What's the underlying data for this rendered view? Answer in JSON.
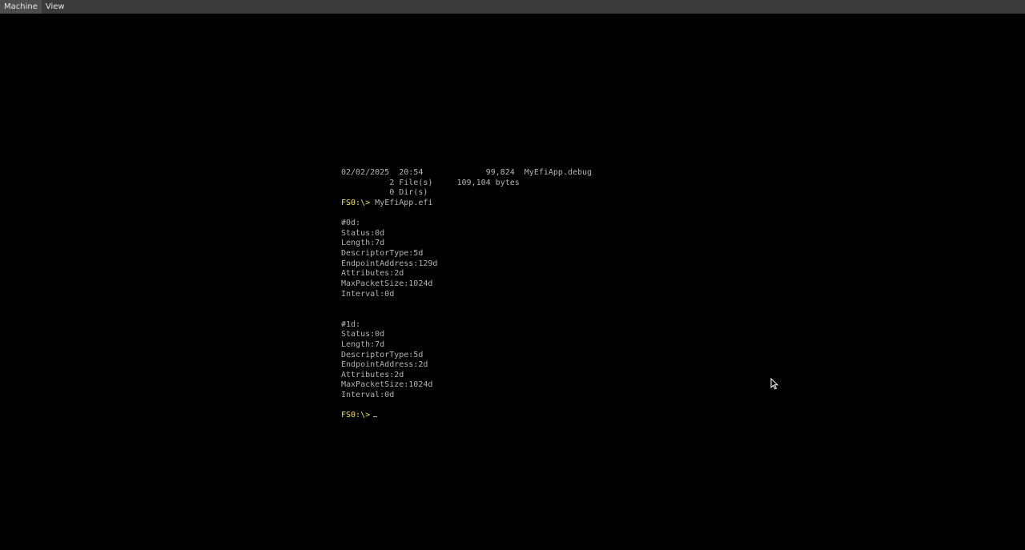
{
  "menubar": {
    "items": [
      {
        "label": "Machine"
      },
      {
        "label": "View"
      }
    ]
  },
  "console": {
    "lines": [
      {
        "text": "02/02/2025  20:54             99,824  MyEfiApp.debug",
        "prompt": ""
      },
      {
        "text": "          2 File(s)     109,104 bytes",
        "prompt": ""
      },
      {
        "text": "          0 Dir(s)",
        "prompt": ""
      },
      {
        "text": "MyEfiApp.efi",
        "prompt": "FS0:\\> "
      },
      {
        "text": "",
        "prompt": ""
      },
      {
        "text": "#0d:",
        "prompt": ""
      },
      {
        "text": "Status:0d",
        "prompt": ""
      },
      {
        "text": "Length:7d",
        "prompt": ""
      },
      {
        "text": "DescriptorType:5d",
        "prompt": ""
      },
      {
        "text": "EndpointAddress:129d",
        "prompt": ""
      },
      {
        "text": "Attributes:2d",
        "prompt": ""
      },
      {
        "text": "MaxPacketSize:1024d",
        "prompt": ""
      },
      {
        "text": "Interval:0d",
        "prompt": ""
      },
      {
        "text": "",
        "prompt": ""
      },
      {
        "text": "",
        "prompt": ""
      },
      {
        "text": "#1d:",
        "prompt": ""
      },
      {
        "text": "Status:0d",
        "prompt": ""
      },
      {
        "text": "Length:7d",
        "prompt": ""
      },
      {
        "text": "DescriptorType:5d",
        "prompt": ""
      },
      {
        "text": "EndpointAddress:2d",
        "prompt": ""
      },
      {
        "text": "Attributes:2d",
        "prompt": ""
      },
      {
        "text": "MaxPacketSize:1024d",
        "prompt": ""
      },
      {
        "text": "Interval:0d",
        "prompt": ""
      },
      {
        "text": "",
        "prompt": ""
      },
      {
        "text": "",
        "prompt": "FS0:\\>",
        "cursor": true
      }
    ]
  },
  "colors": {
    "background": "#000000",
    "text": "#b4b4b4",
    "prompt": "#f2e84a",
    "menubar": "#3a3a3a"
  },
  "icons": {
    "pointer": "mouse-pointer-icon"
  }
}
